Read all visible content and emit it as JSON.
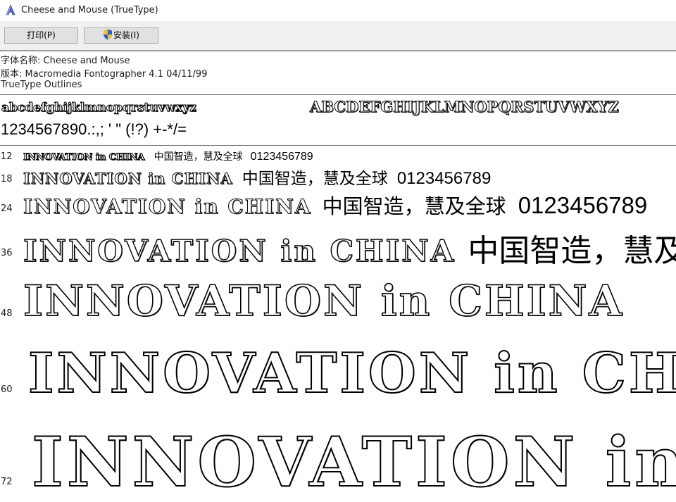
{
  "window": {
    "title": "Cheese and Mouse (TrueType)",
    "icon": "font-viewer-icon"
  },
  "toolbar": {
    "print_label": "打印(P)",
    "install_label": "安装(I)",
    "install_icon": "uac-shield-icon"
  },
  "font_info": {
    "name_line": "字体名称: Cheese and Mouse",
    "version_line": "版本: Macromedia Fontographer 4.1 04/11/99",
    "outline_line": "TrueType Outlines"
  },
  "charset": {
    "lowercase": "abcdefghijklmnopqrstuvwxyz",
    "uppercase": "ABCDEFGHIJKLMNOPQRSTUVWXYZ",
    "digits_symbols": "1234567890.:,; ' \" (!?) +-*/="
  },
  "samples": {
    "latin_text": "INNOVATION in CHINA",
    "cjk_text": "中国智造，慧及全球",
    "number_text": "0123456789"
  },
  "sizes": [
    "12",
    "18",
    "24",
    "36",
    "48",
    "60",
    "72"
  ]
}
